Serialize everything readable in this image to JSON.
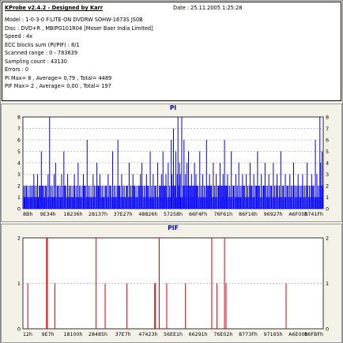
{
  "header": {
    "title": "KProbe v2.4.2 - Designed by Karr",
    "date": "Date : 25.11.2005 1:25:28"
  },
  "info_lines": [
    "Model : 1-0-3-0 F:LITE-ON DVDRW SOHW-1673S JS0B",
    "Disc : DVD+R , MBIPG101R04 [Moser Baer India Limited]",
    "Speed : 4x",
    "ECC blocks sum (PI/PIF) : 8/1",
    "Scanned range : 0 - 783639",
    "Sampling count : 43130",
    "Errors : 0",
    "PI Max= 8 , Average= 0,79 , Total= 4489",
    "PIF Max= 2 , Average= 0,00 , Total= 197"
  ],
  "colors": {
    "pi_series": "#0000ff",
    "pif_series": "#e00000",
    "title": "#0000cc",
    "panel_bg": "#f4f2e8",
    "plot_bg": "#ffffff"
  },
  "chart_data": [
    {
      "type": "bar",
      "title": "PI",
      "ylim": [
        0,
        8
      ],
      "yticks": [
        "0",
        "1",
        "2",
        "3",
        "4",
        "5",
        "6",
        "7",
        "8"
      ],
      "xticks": [
        "8Bh",
        "9E34h",
        "18236h",
        "28137h",
        "37E27h",
        "48826h",
        "57258h",
        "66F4Fh",
        "76F61h",
        "86F16h",
        "96927h",
        "A6F05h",
        "B741Fh"
      ],
      "grid": true,
      "series": [
        {
          "points": [
            [
              1,
              2
            ],
            [
              2,
              1
            ],
            [
              4,
              2
            ],
            [
              6,
              1
            ],
            [
              9,
              2
            ],
            [
              11,
              2
            ],
            [
              14,
              3
            ],
            [
              15,
              1
            ],
            [
              17,
              2
            ],
            [
              19,
              3
            ],
            [
              20,
              1
            ],
            [
              22,
              2
            ],
            [
              24,
              5
            ],
            [
              26,
              2
            ],
            [
              28,
              1
            ],
            [
              30,
              2
            ],
            [
              33,
              3
            ],
            [
              35,
              8
            ],
            [
              37,
              2
            ],
            [
              39,
              1
            ],
            [
              41,
              3
            ],
            [
              43,
              4
            ],
            [
              46,
              2
            ],
            [
              49,
              2
            ],
            [
              51,
              3
            ],
            [
              54,
              5
            ],
            [
              56,
              2
            ],
            [
              59,
              3
            ],
            [
              61,
              2
            ],
            [
              63,
              2
            ],
            [
              66,
              1
            ],
            [
              68,
              3
            ],
            [
              71,
              2
            ],
            [
              73,
              4
            ],
            [
              75,
              2
            ],
            [
              77,
              1
            ],
            [
              80,
              3
            ],
            [
              82,
              2
            ],
            [
              85,
              6
            ],
            [
              87,
              2
            ],
            [
              90,
              1
            ],
            [
              93,
              3
            ],
            [
              95,
              2
            ],
            [
              98,
              4
            ],
            [
              100,
              2
            ],
            [
              102,
              3
            ],
            [
              105,
              2
            ],
            [
              107,
              1
            ],
            [
              110,
              2
            ],
            [
              113,
              3
            ],
            [
              116,
              2
            ],
            [
              119,
              5
            ],
            [
              121,
              2
            ],
            [
              123,
              1
            ],
            [
              126,
              6
            ],
            [
              128,
              2
            ],
            [
              131,
              3
            ],
            [
              133,
              2
            ],
            [
              136,
              1
            ],
            [
              138,
              2
            ],
            [
              141,
              4
            ],
            [
              143,
              2
            ],
            [
              146,
              3
            ],
            [
              148,
              2
            ],
            [
              151,
              1
            ],
            [
              154,
              2
            ],
            [
              156,
              3
            ],
            [
              158,
              4
            ],
            [
              161,
              2
            ],
            [
              164,
              3
            ],
            [
              166,
              2
            ],
            [
              169,
              5
            ],
            [
              171,
              2
            ],
            [
              173,
              3
            ],
            [
              176,
              2
            ],
            [
              179,
              4
            ],
            [
              182,
              2
            ],
            [
              184,
              3
            ],
            [
              186,
              5
            ],
            [
              188,
              2
            ],
            [
              190,
              3
            ],
            [
              193,
              4
            ],
            [
              195,
              2
            ],
            [
              197,
              6
            ],
            [
              198,
              3
            ],
            [
              200,
              7
            ],
            [
              202,
              2
            ],
            [
              203,
              5
            ],
            [
              205,
              3
            ],
            [
              206,
              8
            ],
            [
              208,
              4
            ],
            [
              209,
              3
            ],
            [
              211,
              8
            ],
            [
              213,
              2
            ],
            [
              214,
              6
            ],
            [
              216,
              3
            ],
            [
              218,
              4
            ],
            [
              220,
              5
            ],
            [
              222,
              2
            ],
            [
              224,
              3
            ],
            [
              226,
              2
            ],
            [
              228,
              4
            ],
            [
              230,
              3
            ],
            [
              232,
              2
            ],
            [
              235,
              5
            ],
            [
              237,
              2
            ],
            [
              239,
              3
            ],
            [
              241,
              2
            ],
            [
              244,
              6
            ],
            [
              246,
              2
            ],
            [
              248,
              3
            ],
            [
              250,
              2
            ],
            [
              253,
              4
            ],
            [
              255,
              2
            ],
            [
              257,
              3
            ],
            [
              260,
              2
            ],
            [
              262,
              4
            ],
            [
              264,
              2
            ],
            [
              266,
              3
            ],
            [
              268,
              6
            ],
            [
              270,
              2
            ],
            [
              272,
              3
            ],
            [
              275,
              2
            ],
            [
              277,
              5
            ],
            [
              280,
              2
            ],
            [
              283,
              3
            ],
            [
              285,
              2
            ],
            [
              287,
              4
            ],
            [
              289,
              2
            ],
            [
              292,
              3
            ],
            [
              294,
              2
            ],
            [
              297,
              3
            ],
            [
              299,
              2
            ],
            [
              302,
              4
            ],
            [
              304,
              2
            ],
            [
              307,
              3
            ],
            [
              310,
              2
            ],
            [
              312,
              5
            ],
            [
              314,
              2
            ],
            [
              317,
              3
            ],
            [
              320,
              2
            ],
            [
              322,
              4
            ],
            [
              325,
              2
            ],
            [
              327,
              3
            ],
            [
              330,
              2
            ],
            [
              333,
              4
            ],
            [
              335,
              2
            ],
            [
              338,
              3
            ],
            [
              341,
              2
            ],
            [
              343,
              5
            ],
            [
              346,
              2
            ],
            [
              349,
              3
            ],
            [
              352,
              2
            ],
            [
              355,
              3
            ],
            [
              357,
              2
            ],
            [
              360,
              4
            ],
            [
              363,
              2
            ],
            [
              366,
              3
            ],
            [
              369,
              2
            ],
            [
              372,
              3
            ],
            [
              375,
              2
            ],
            [
              378,
              4
            ],
            [
              381,
              2
            ],
            [
              384,
              3
            ],
            [
              386,
              2
            ],
            [
              389,
              6
            ],
            [
              391,
              3
            ],
            [
              393,
              2
            ],
            [
              395,
              8
            ],
            [
              396,
              4
            ],
            [
              398,
              5
            ],
            [
              399,
              2
            ]
          ],
          "baseline": [
            1,
            2
          ]
        }
      ]
    },
    {
      "type": "bar",
      "title": "PIF",
      "ylim": [
        0,
        2
      ],
      "yticks": [
        "0",
        "1",
        "2"
      ],
      "xticks": [
        "12h",
        "9E7h",
        "18100h",
        "28485h",
        "37E7h",
        "47423h",
        "56EE1h",
        "66291h",
        "76E02h",
        "8773Fh",
        "97165h",
        "A6E00h",
        "B6FBFh"
      ],
      "grid": true,
      "series": [
        {
          "points": [
            [
              6,
              1
            ],
            [
              31,
              2
            ],
            [
              32,
              2
            ],
            [
              42,
              1
            ],
            [
              97,
              2
            ],
            [
              109,
              1
            ],
            [
              138,
              1
            ],
            [
              175,
              1
            ],
            [
              176,
              1
            ],
            [
              181,
              2
            ],
            [
              191,
              1
            ],
            [
              216,
              1
            ],
            [
              251,
              2
            ],
            [
              258,
              1
            ],
            [
              268,
              2
            ],
            [
              270,
              1
            ],
            [
              350,
              1
            ]
          ]
        }
      ]
    }
  ]
}
